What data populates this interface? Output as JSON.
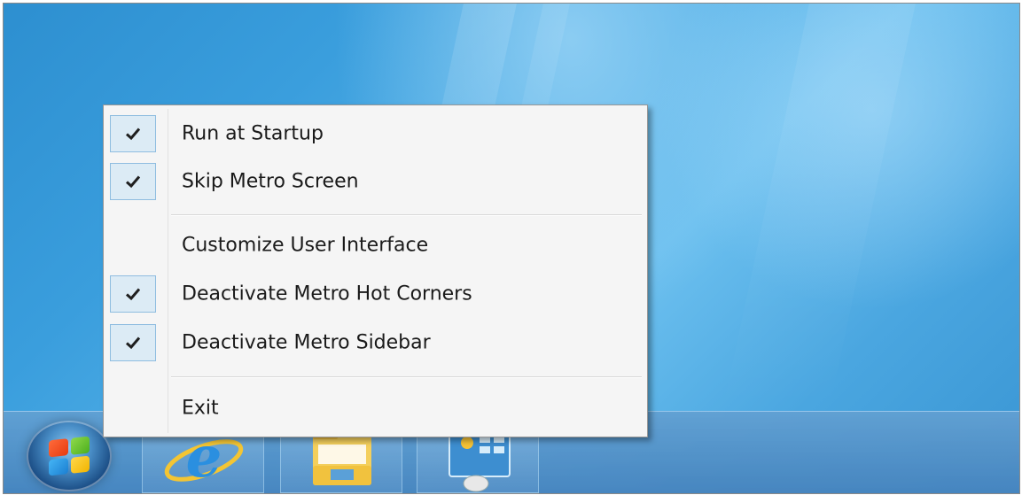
{
  "context_menu": {
    "items": [
      {
        "label": "Run at Startup",
        "checked": true
      },
      {
        "label": "Skip Metro Screen",
        "checked": true
      },
      {
        "label": "Customize User Interface",
        "checked": false
      },
      {
        "label": "Deactivate Metro Hot Corners",
        "checked": true
      },
      {
        "label": "Deactivate Metro Sidebar",
        "checked": true
      },
      {
        "label": "Exit",
        "checked": false
      }
    ]
  },
  "taskbar": {
    "pinned_apps": [
      {
        "icon": "internet-explorer-icon"
      },
      {
        "icon": "file-explorer-icon"
      },
      {
        "icon": "control-panel-icon"
      }
    ]
  },
  "colors": {
    "desktop": "#3a9edd",
    "taskbar": "#5b9bd0",
    "menu_background": "#f5f5f5",
    "check_highlight": "#dcebf5"
  }
}
